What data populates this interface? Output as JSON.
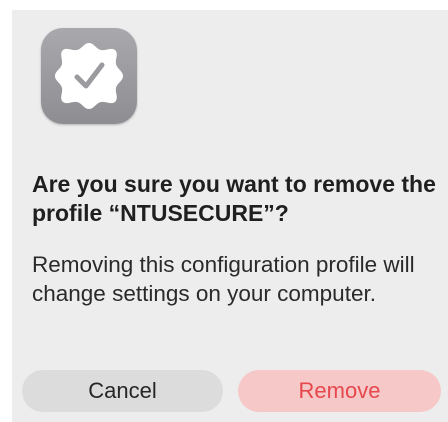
{
  "dialog": {
    "icon": "verified-badge-checkmark-icon",
    "title": "Are you sure you want to remove the profile “NTUSECURE”?",
    "message": "Removing this configuration profile will change settings on your computer.",
    "buttons": {
      "cancel_label": "Cancel",
      "remove_label": "Remove"
    }
  },
  "colors": {
    "dialog_background": "#ededed",
    "cancel_button": "#dcdcdc",
    "remove_button": "#f6c8c8",
    "remove_text": "#e5484d"
  }
}
